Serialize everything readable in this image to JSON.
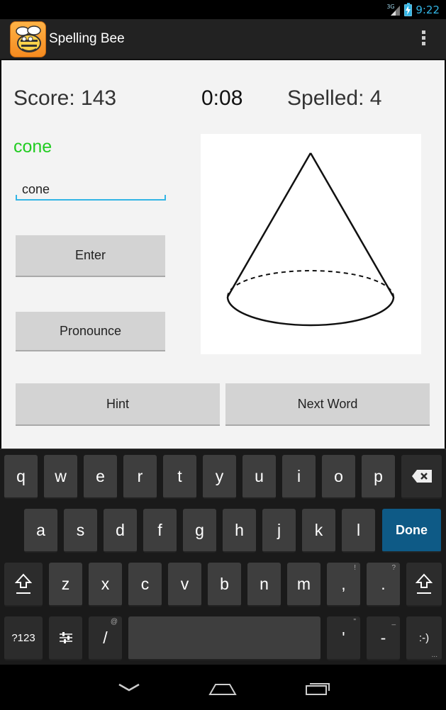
{
  "status_bar": {
    "network": "3G",
    "time": "9:22"
  },
  "action_bar": {
    "title": "Spelling Bee"
  },
  "game": {
    "score_text": "Score: 143",
    "timer_text": "0:08",
    "spelled_text": "Spelled: 4",
    "current_word": "cone",
    "input_value": "cone",
    "enter_label": "Enter",
    "pronounce_label": "Pronounce",
    "hint_label": "Hint",
    "next_label": "Next Word"
  },
  "keyboard": {
    "row1": [
      "q",
      "w",
      "e",
      "r",
      "t",
      "y",
      "u",
      "i",
      "o",
      "p"
    ],
    "row2": [
      "a",
      "s",
      "d",
      "f",
      "g",
      "h",
      "j",
      "k",
      "l"
    ],
    "row3": [
      "z",
      "x",
      "c",
      "v",
      "b",
      "n",
      "m"
    ],
    "comma": ",",
    "comma_alt": "!",
    "period": ".",
    "period_alt": "?",
    "done_label": "Done",
    "symbols_label": "?123",
    "slash": "/",
    "slash_alt": "@",
    "apostrophe": "'",
    "apostrophe_alt": "\"",
    "dash": "-",
    "dash_alt": "_",
    "smiley": ":-)",
    "smiley_alt": "..."
  },
  "colors": {
    "accent": "#33b5e5",
    "word_color": "#22cc22",
    "done_key": "#0e5a86"
  }
}
